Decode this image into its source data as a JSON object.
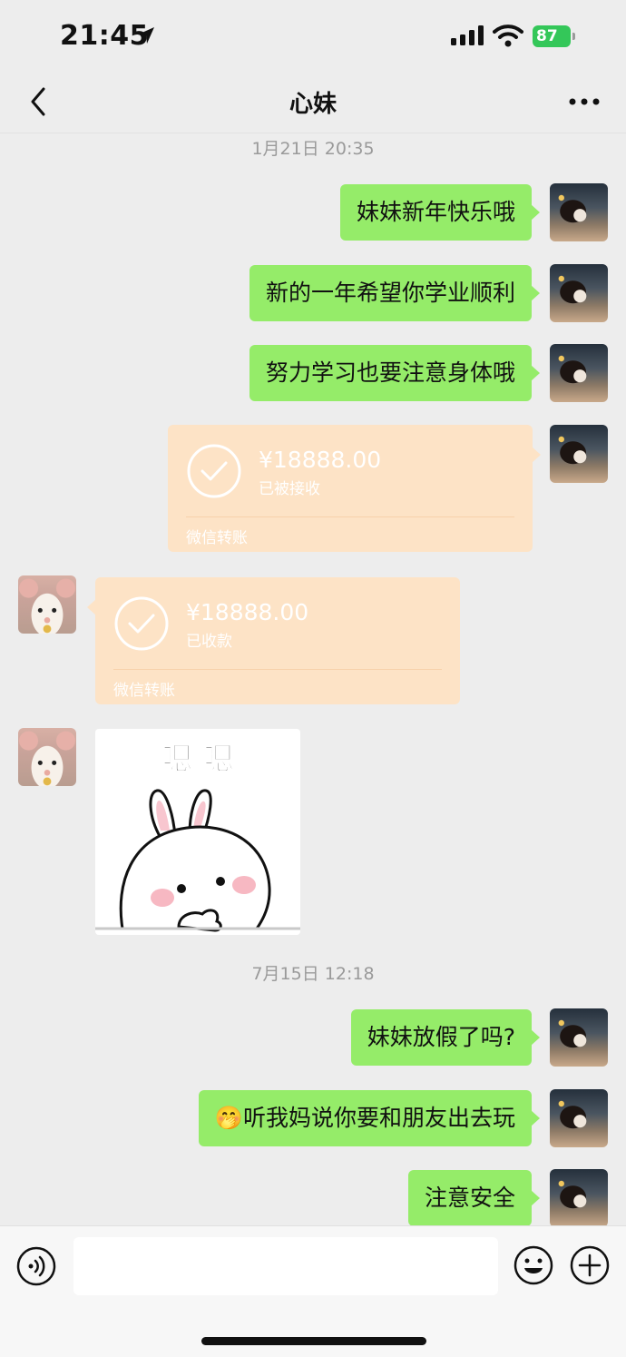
{
  "status_bar": {
    "time": "21:45",
    "battery": "87"
  },
  "header": {
    "title": "心妹"
  },
  "messages": {
    "ts1": "1月21日 20:35",
    "m1": "妹妹新年快乐哦",
    "m2": "新的一年希望你学业顺利",
    "m3": "努力学习也要注意身体哦",
    "transfer_sent": {
      "amount": "¥18888.00",
      "status": "已被接收",
      "footer": "微信转账"
    },
    "transfer_received": {
      "amount": "¥18888.00",
      "status": "已收款",
      "footer": "微信转账"
    },
    "sticker_text": "嗯 嗯",
    "ts2": "7月15日 12:18",
    "m4": "妹妹放假了吗?",
    "m5": "🤭听我妈说你要和朋友出去玩",
    "m6": "注意安全"
  },
  "input": {
    "value": ""
  },
  "colors": {
    "bubble_me": "#95ec69",
    "transfer": "#fde3c6",
    "background": "#ededed",
    "battery": "#34c759"
  }
}
